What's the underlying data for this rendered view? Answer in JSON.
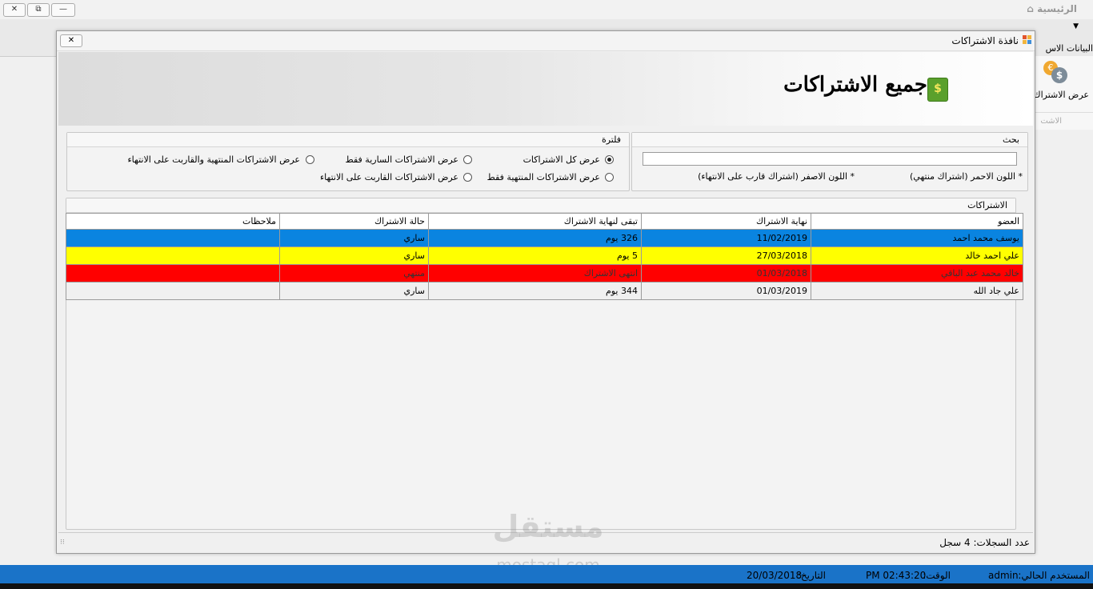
{
  "app": {
    "title": "الرئيسية",
    "ribbon_label": "البيانات الاس",
    "ribbon_button_label": "عرض الاشتراك",
    "ribbon_group_label": "الاشت",
    "window_buttons": [
      "—",
      "⧉",
      "✕"
    ]
  },
  "dialog": {
    "title": "نافذة الاشتراكات",
    "close_label": "✕",
    "banner_title": "جميع الاشتراكات"
  },
  "search": {
    "header": "بحث",
    "value": "",
    "legend_red": "* اللون الاحمر (اشتراك منتهي)",
    "legend_yellow": "* اللون الاصفر (اشتراك قارب على الانتهاء)"
  },
  "filter": {
    "header": "فلترة",
    "options": [
      {
        "label": "عرض كل الاشتراكات",
        "selected": true
      },
      {
        "label": "عرض الاشتراكات السارية فقط",
        "selected": false
      },
      {
        "label": "عرض الاشتراكات المنتهية والقاربت على الانتهاء",
        "selected": false
      },
      {
        "label": "عرض الاشتراكات المنتهية فقط",
        "selected": false
      },
      {
        "label": "عرض الاشتراكات القاربت على الانتهاء",
        "selected": false
      }
    ]
  },
  "grid": {
    "header": "الاشتراكات",
    "columns": [
      "العضو",
      "نهاية الاشتراك",
      "تبقى لنهاية الاشتراك",
      "حالة الاشتراك",
      "ملاحظات"
    ],
    "rows": [
      {
        "member": "يوسف محمد احمد",
        "end": "11/02/2019",
        "remaining": "326 يوم",
        "status": "ساري",
        "notes": "",
        "color": "#0a84e0"
      },
      {
        "member": "علي احمد خالد",
        "end": "27/03/2018",
        "remaining": "5 يوم",
        "status": "ساري",
        "notes": "",
        "color": "#ffff00"
      },
      {
        "member": "خالد محمد عبد الباقي",
        "end": "01/03/2018",
        "remaining": "انتهى الاشتراك",
        "status": "منتهي",
        "notes": "",
        "color": "#ff0000"
      },
      {
        "member": "علي جاد الله",
        "end": "01/03/2019",
        "remaining": "344 يوم",
        "status": "ساري",
        "notes": "",
        "color": "#f0f0f0"
      }
    ]
  },
  "footer": {
    "record_count_label": "عدد السجلات:",
    "record_count_value": "4 سجل"
  },
  "status": {
    "user_label": "المستخدم الحالي:",
    "user_value": "admin",
    "time_label": "الوقت:",
    "time_value": "PM 02:43:20",
    "date_label": "التاريخ:",
    "date_value": "20/03/2018"
  },
  "watermark": {
    "brand": "مستقل",
    "domain": "mostaql.com"
  }
}
